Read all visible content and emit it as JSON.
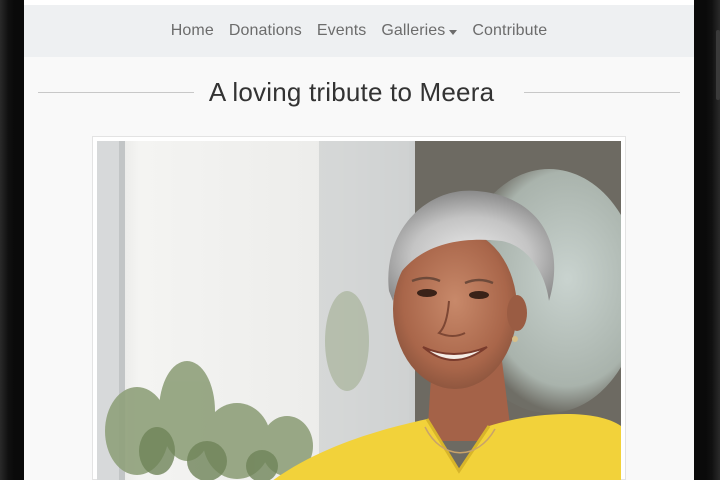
{
  "nav": {
    "items": [
      {
        "label": "Home"
      },
      {
        "label": "Donations"
      },
      {
        "label": "Events"
      },
      {
        "label": "Galleries",
        "has_dropdown": true
      },
      {
        "label": "Contribute"
      }
    ]
  },
  "page": {
    "title": "A loving tribute to Meera"
  },
  "photo": {
    "icon": "portrait-photo"
  },
  "colors": {
    "navbar_bg": "#eef0f2",
    "nav_text": "#6c6c6c",
    "title_text": "#333333",
    "sweater": "#f2d23a"
  }
}
